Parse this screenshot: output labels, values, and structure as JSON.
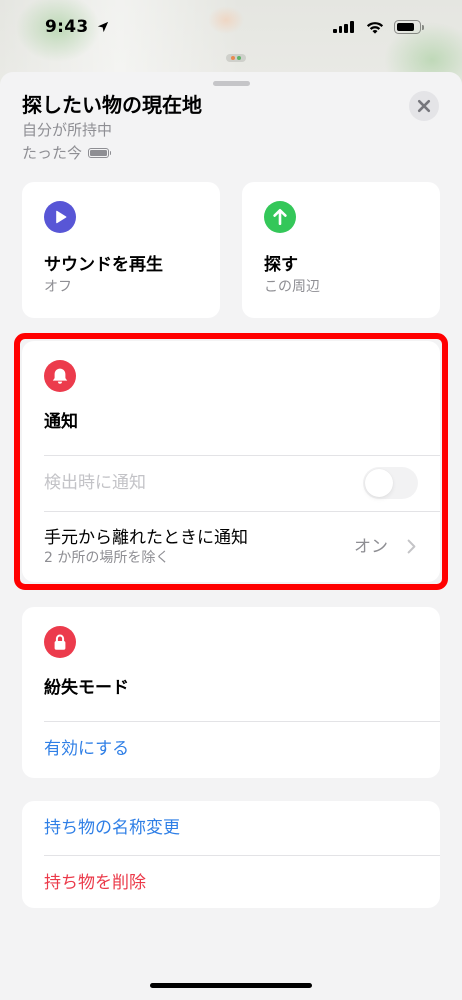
{
  "status_bar": {
    "time": "9:43",
    "battery_level": 0.8,
    "icons": [
      "location-arrow-icon",
      "cellular-signal-icon",
      "wifi-icon",
      "battery-icon"
    ]
  },
  "sheet": {
    "title": "探したい物の現在地",
    "subtitle": "自分が所持中",
    "updated": "たった今",
    "item_battery_level": 1.0,
    "close_icon": "close-icon"
  },
  "actions": [
    {
      "label": "サウンドを再生",
      "detail": "オフ",
      "icon": "play-icon",
      "color": "#5856d6"
    },
    {
      "label": "探す",
      "detail": "この周辺",
      "icon": "arrow-up-icon",
      "color": "#34c759"
    }
  ],
  "notifications": {
    "title": "通知",
    "icon": "bell-icon",
    "color": "#ec3b4c",
    "notify_when_found": {
      "label": "検出時に通知",
      "on": false,
      "disabled": true
    },
    "notify_when_left_behind": {
      "label": "手元から離れたときに通知",
      "detail": "2 か所の場所を除く",
      "value": "オン",
      "icon": "chevron-right-icon"
    }
  },
  "lost_mode": {
    "title": "紛失モード",
    "icon": "lock-icon",
    "color": "#ec3b4c",
    "action": "有効にする"
  },
  "item_actions": {
    "rename": "持ち物の名称変更",
    "remove": "持ち物を削除"
  },
  "colors": {
    "accent_blue": "#2f7fe6",
    "destructive_red": "#eb3a4a",
    "secondary_text": "#8e8e93",
    "highlight_border": "#ff0000"
  }
}
